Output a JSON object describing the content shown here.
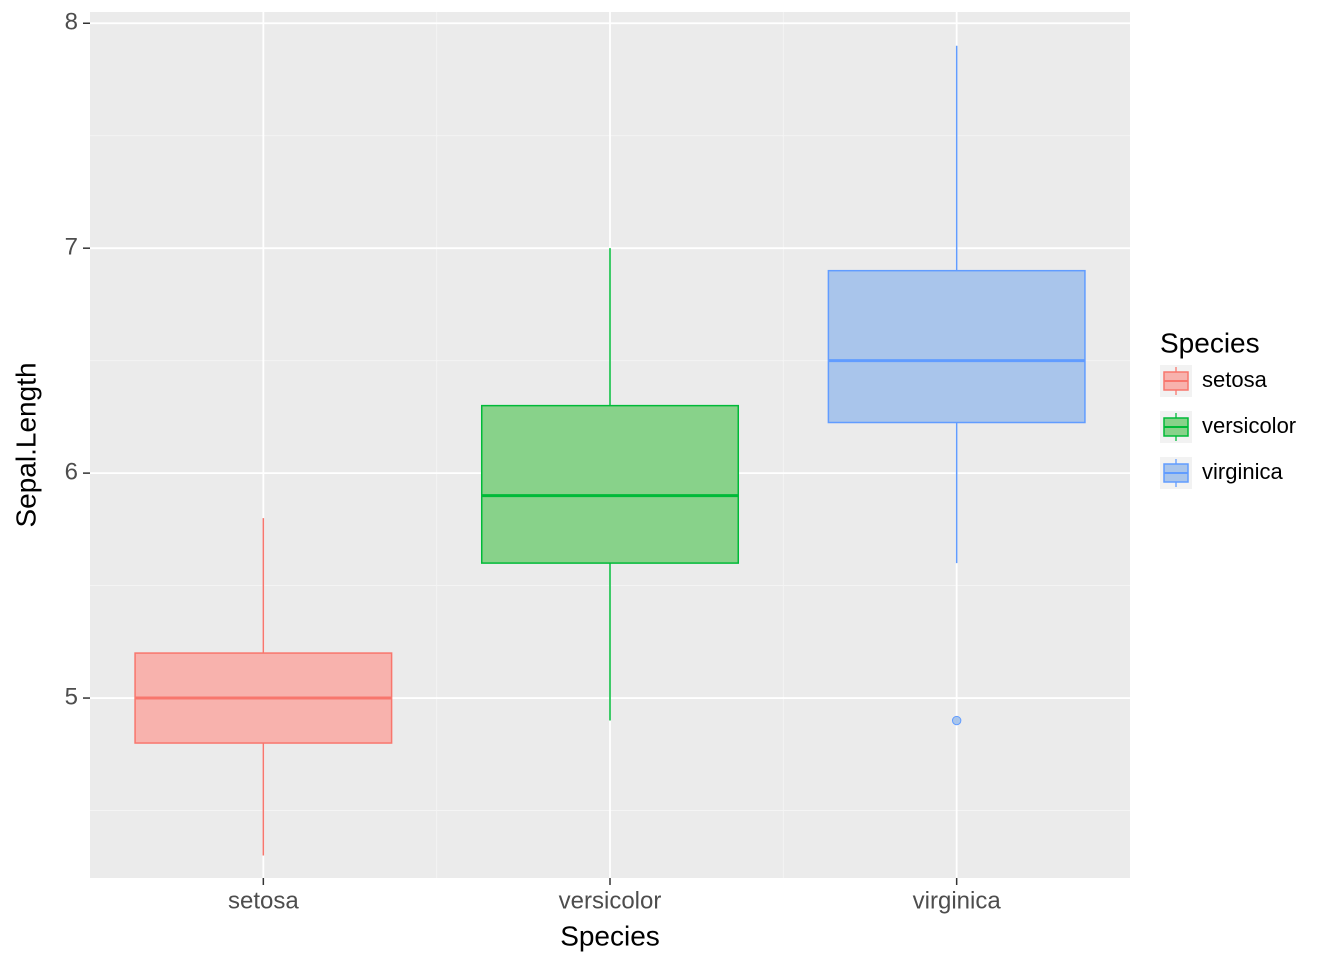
{
  "chart_data": {
    "type": "boxplot",
    "xlabel": "Species",
    "ylabel": "Sepal.Length",
    "legend_title": "Species",
    "xlim_padded": true,
    "ylim": [
      4.2,
      8.05
    ],
    "y_ticks": [
      5,
      6,
      7,
      8
    ],
    "categories": [
      "setosa",
      "versicolor",
      "virginica"
    ],
    "series": [
      {
        "name": "setosa",
        "fill": "#f8b2ad",
        "stroke": "#f8766d",
        "lower_whisker": 4.3,
        "q1": 4.8,
        "median": 5.0,
        "q3": 5.2,
        "upper_whisker": 5.8,
        "outliers": []
      },
      {
        "name": "versicolor",
        "fill": "#88d28a",
        "stroke": "#00ba38",
        "lower_whisker": 4.9,
        "q1": 5.6,
        "median": 5.9,
        "q3": 6.3,
        "upper_whisker": 7.0,
        "outliers": []
      },
      {
        "name": "virginica",
        "fill": "#a9c5eb",
        "stroke": "#619cff",
        "lower_whisker": 5.6,
        "q1": 6.225,
        "median": 6.5,
        "q3": 6.9,
        "upper_whisker": 7.9,
        "outliers": [
          4.9
        ]
      }
    ]
  }
}
